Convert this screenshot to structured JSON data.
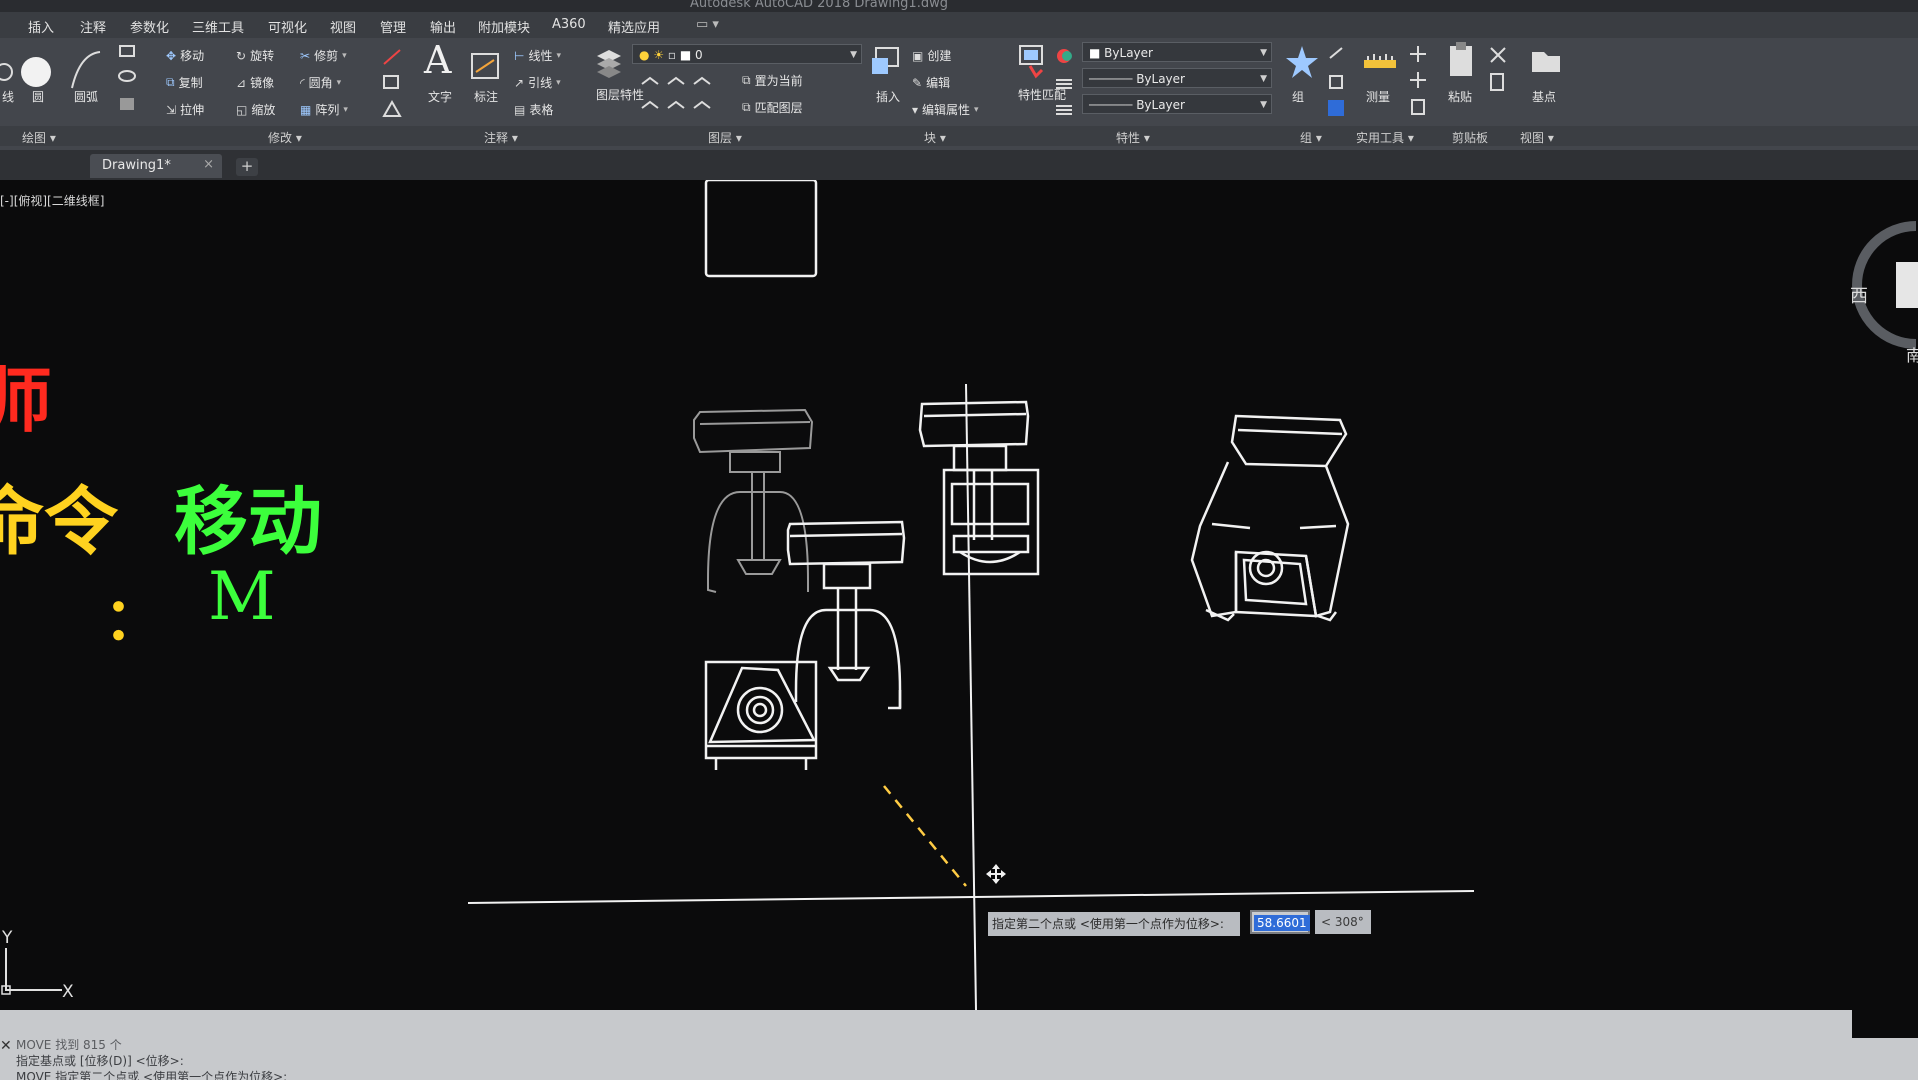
{
  "window": {
    "title": "Autodesk AutoCAD 2018    Drawing1.dwg"
  },
  "menu": {
    "items": [
      "插入",
      "注释",
      "参数化",
      "三维工具",
      "可视化",
      "视图",
      "管理",
      "输出",
      "附加模块",
      "A360",
      "精选应用"
    ]
  },
  "ribbon": {
    "draw": {
      "label": "绘图",
      "line_tool": "线",
      "circle_tool": "圆",
      "arc_tool": "圆弧"
    },
    "modify": {
      "label": "修改",
      "move": "移动",
      "rotate": "旋转",
      "trim": "修剪",
      "copy": "复制",
      "mirror": "镜像",
      "fillet": "圆角",
      "stretch": "拉伸",
      "scale": "缩放",
      "array": "阵列"
    },
    "annotation": {
      "label": "注释",
      "text": "文字",
      "dimension": "标注",
      "linear": "线性",
      "leader": "引线",
      "table": "表格"
    },
    "layers": {
      "label": "图层",
      "layer_props": "图层特性",
      "current_layer": "0",
      "set_current": "置为当前",
      "match_layer": "匹配图层"
    },
    "block": {
      "label": "块",
      "insert": "插入",
      "create": "创建",
      "edit": "编辑",
      "edit_attributes": "编辑属性"
    },
    "properties": {
      "label": "特性",
      "match": "特性匹配",
      "color": "ByLayer",
      "linetype": "ByLayer",
      "lineweight": "ByLayer"
    },
    "groups": {
      "label": "组",
      "group": "组"
    },
    "utilities": {
      "label": "实用工具",
      "measure": "测量"
    },
    "clipboard": {
      "label": "剪贴板",
      "paste": "粘贴"
    },
    "view": {
      "label": "视图",
      "base": "基点"
    }
  },
  "tabs": {
    "doc_tab": "Drawing1*",
    "close": "×",
    "add": "+"
  },
  "viewport": {
    "label": "[-][俯视][二维线框]"
  },
  "overlay": {
    "red_char": "师",
    "command": "命令",
    "command_name": "移动",
    "colon": "：",
    "shortcut": "M"
  },
  "viewcube": {
    "west": "西",
    "south": "南"
  },
  "dynamic_input": {
    "prompt": "指定第二个点或 <使用第一个点作为位移>:",
    "distance": "58.6601",
    "angle": "< 308°"
  },
  "ucs": {
    "y": "Y",
    "x": "X"
  },
  "command_history": [
    "MOVE 找到 815 个",
    "指定基点或 [位移(D)] <位移>:",
    "MOVE 指定第二个点或 <使用第一个点作为位移>:"
  ],
  "colors": {
    "red": "#ff2a1f",
    "yellow": "#ffd21f",
    "green": "#3cff3c",
    "highlight": "#2f6cd8",
    "tracking": "#ffcc44"
  }
}
